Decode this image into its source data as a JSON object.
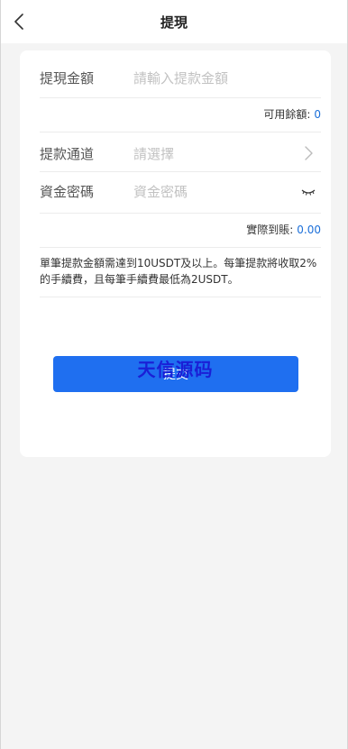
{
  "header": {
    "title": "提現",
    "back_icon": "chevron-left-icon"
  },
  "form": {
    "amount": {
      "label": "提現金額",
      "placeholder": "請輸入提款金額"
    },
    "available": {
      "label": "可用餘額:",
      "value": "0"
    },
    "channel": {
      "label": "提款通道",
      "placeholder": "請選擇",
      "icon": "chevron-right-icon"
    },
    "password": {
      "label": "資金密碼",
      "placeholder": "資金密碼",
      "icon": "eye-closed-icon"
    },
    "actual": {
      "label": "實際到賬:",
      "value": "0.00"
    },
    "note": "單筆提款金額需達到10USDT及以上。每筆提款將收取2%的手續費，且每筆手續費最低為2USDT。"
  },
  "submit": {
    "label": "提交"
  },
  "watermark": "天信源码",
  "colors": {
    "accent": "#1f6ff0",
    "value_blue": "#1b6fd9",
    "watermark": "#1a1fd6"
  }
}
